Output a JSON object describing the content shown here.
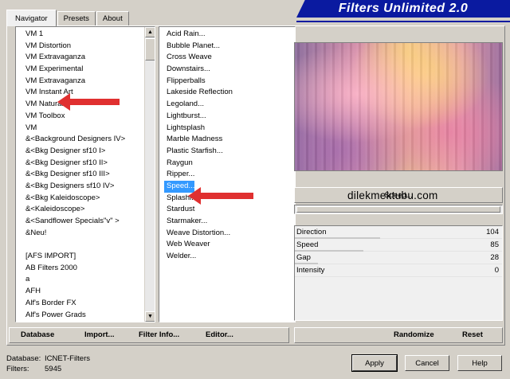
{
  "tabs": [
    {
      "label": "Navigator"
    },
    {
      "label": "Presets"
    },
    {
      "label": "About"
    }
  ],
  "app_title": "Filters Unlimited 2.0",
  "categories": [
    "VM 1",
    "VM Distortion",
    "VM Extravaganza",
    "VM Experimental",
    "VM Extravaganza",
    "VM Instant Art",
    "VM Natural",
    "VM Toolbox",
    "VM",
    "&<Background Designers IV>",
    "&<Bkg Designer sf10 I>",
    "&<Bkg Designer sf10 II>",
    "&<Bkg Designer sf10 III>",
    "&<Bkg Designers sf10 IV>",
    "&<Bkg Kaleidoscope>",
    "&<Kaleidoscope>",
    "&<Sandflower Specials\"v\" >",
    "&Neu!",
    "",
    "[AFS IMPORT]",
    "AB Filters 2000",
    "a",
    "AFH",
    "Alf's Border FX",
    "Alf's Power Grads"
  ],
  "filters": [
    "Acid Rain...",
    "Bubble Planet...",
    "Cross Weave",
    "Downstairs...",
    "Flipperballs",
    "Lakeside Reflection",
    "Legoland...",
    "Lightburst...",
    "Lightsplash",
    "Marble Madness",
    "Plastic Starfish...",
    "Raygun",
    "Ripper...",
    "Speed...",
    "Splashl...",
    "Stardust",
    "Starmaker...",
    "Weave Distortion...",
    "Web Weaver",
    "Welder..."
  ],
  "selected_filter_index": 13,
  "selected_filter_name": "Speed...",
  "watermark": "dilekmektubu.com",
  "params": [
    {
      "name": "Direction",
      "value": "104",
      "fraction": 0.41
    },
    {
      "name": "Speed",
      "value": "85",
      "fraction": 0.33
    },
    {
      "name": "Gap",
      "value": "28",
      "fraction": 0.11
    },
    {
      "name": "Intensity",
      "value": "0",
      "fraction": 0.0
    }
  ],
  "left_buttons": {
    "database": "Database",
    "import": "Import...",
    "filter_info": "Filter Info...",
    "editor": "Editor..."
  },
  "right_buttons": {
    "randomize": "Randomize",
    "reset": "Reset"
  },
  "status": {
    "database_label": "Database:",
    "database_value": "ICNET-Filters",
    "filters_label": "Filters:",
    "filters_value": "5945"
  },
  "dialog_buttons": {
    "apply": "Apply",
    "cancel": "Cancel",
    "help": "Help"
  },
  "colors": {
    "selection": "#3399ff",
    "title_banner": "#0a1aa0",
    "annotation_arrow": "#e03030"
  }
}
